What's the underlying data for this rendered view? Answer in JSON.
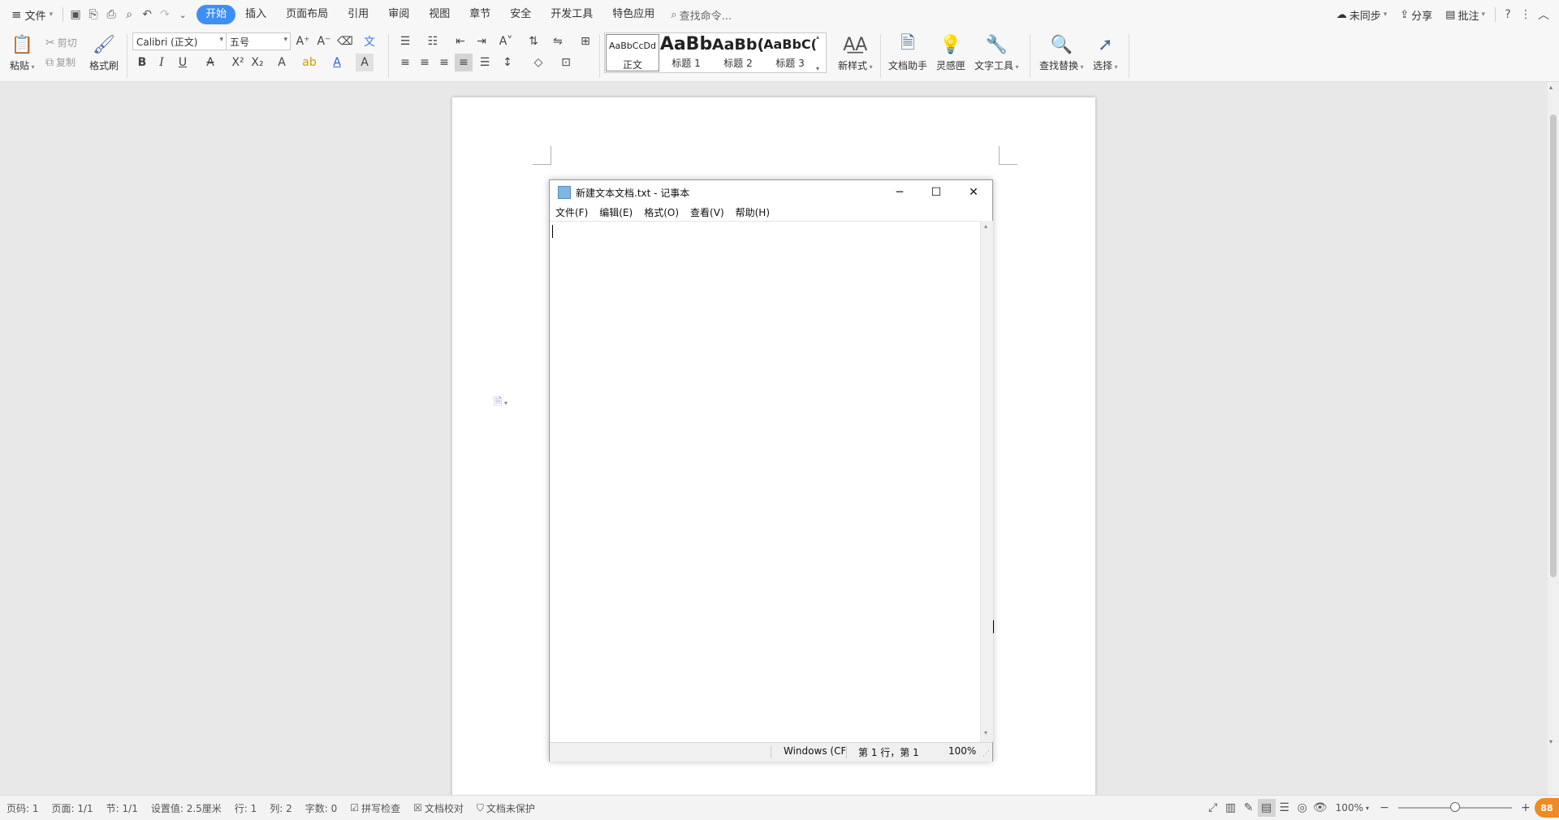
{
  "menubar": {
    "file_label": "文件",
    "tabs": [
      "开始",
      "插入",
      "页面布局",
      "引用",
      "审阅",
      "视图",
      "章节",
      "安全",
      "开发工具",
      "特色应用"
    ],
    "active_tab": "开始",
    "search_placeholder": "查找命令...",
    "sync_label": "未同步",
    "share_label": "分享",
    "comment_label": "批注"
  },
  "ribbon": {
    "paste_label": "粘贴",
    "cut_label": "剪切",
    "copy_label": "复制",
    "format_painter_label": "格式刷",
    "font_name": "Calibri (正文)",
    "font_size": "五号",
    "styles": [
      {
        "sample": "AaBbCcDd",
        "name": "正文"
      },
      {
        "sample": "AaBb",
        "name": "标题 1"
      },
      {
        "sample": "AaBb(",
        "name": "标题 2"
      },
      {
        "sample": "AaBbC(",
        "name": "标题 3"
      }
    ],
    "new_style_label": "新样式",
    "doc_assistant_label": "文档助手",
    "inspiration_label": "灵感匣",
    "text_tools_label": "文字工具",
    "find_replace_label": "查找替换",
    "select_label": "选择"
  },
  "notepad": {
    "title": "新建文本文档.txt - 记事本",
    "menus": [
      "文件(F)",
      "编辑(E)",
      "格式(O)",
      "查看(V)",
      "帮助(H)"
    ],
    "status_encoding": "Windows (CF",
    "status_position": "第 1 行，第 1",
    "status_zoom": "100%"
  },
  "statusbar": {
    "page_num": "页码: 1",
    "pages": "页面: 1/1",
    "section": "节: 1/1",
    "setting": "设置值: 2.5厘米",
    "row": "行: 1",
    "col": "列: 2",
    "word_count": "字数: 0",
    "spell_check": "拼写检查",
    "proofread": "文档校对",
    "protection": "文档未保护",
    "zoom": "100%",
    "badge": "88"
  }
}
